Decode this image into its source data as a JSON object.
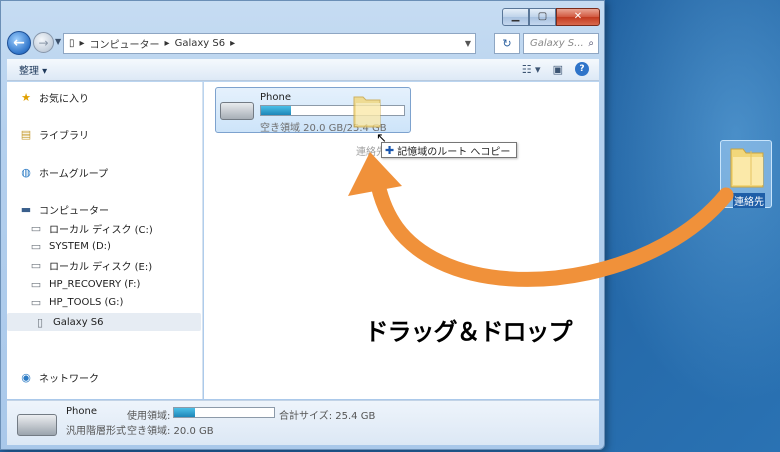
{
  "window": {
    "caption_buttons": [
      "minimize",
      "maximize",
      "close"
    ]
  },
  "navbar": {
    "address_segments": [
      "コンピューター",
      "Galaxy S6"
    ],
    "search_placeholder": "Galaxy S..."
  },
  "toolbar": {
    "organize_label": "整理"
  },
  "sidebar": {
    "favorites": "お気に入り",
    "libraries": "ライブラリ",
    "homegroup": "ホームグループ",
    "computer": "コンピューター",
    "drives": [
      "ローカル ディスク (C:)",
      "SYSTEM (D:)",
      "ローカル ディスク (E:)",
      "HP_RECOVERY (F:)",
      "HP_TOOLS (G:)",
      "Galaxy S6"
    ],
    "selected_drive": "Galaxy S6",
    "network": "ネットワーク"
  },
  "content": {
    "storage": {
      "name": "Phone",
      "free_text": "空き領域 20.0 GB/25.4 GB",
      "used_fraction": 0.21
    },
    "drag_ghost_label": "連絡先",
    "copy_tooltip": "記憶域のルート へコピー"
  },
  "details": {
    "name": "Phone",
    "type": "汎用階層形式",
    "used_label": "使用領域:",
    "used_fraction": 0.21,
    "total_text": "合計サイズ: 25.4 GB",
    "free_text": "空き領域: 20.0 GB"
  },
  "desktop": {
    "folder_label": "連絡先"
  },
  "callout": {
    "text": "ドラッグ＆ドロップ"
  },
  "colors": {
    "arrow": "#f0913a",
    "accent": "#2f74c9"
  }
}
